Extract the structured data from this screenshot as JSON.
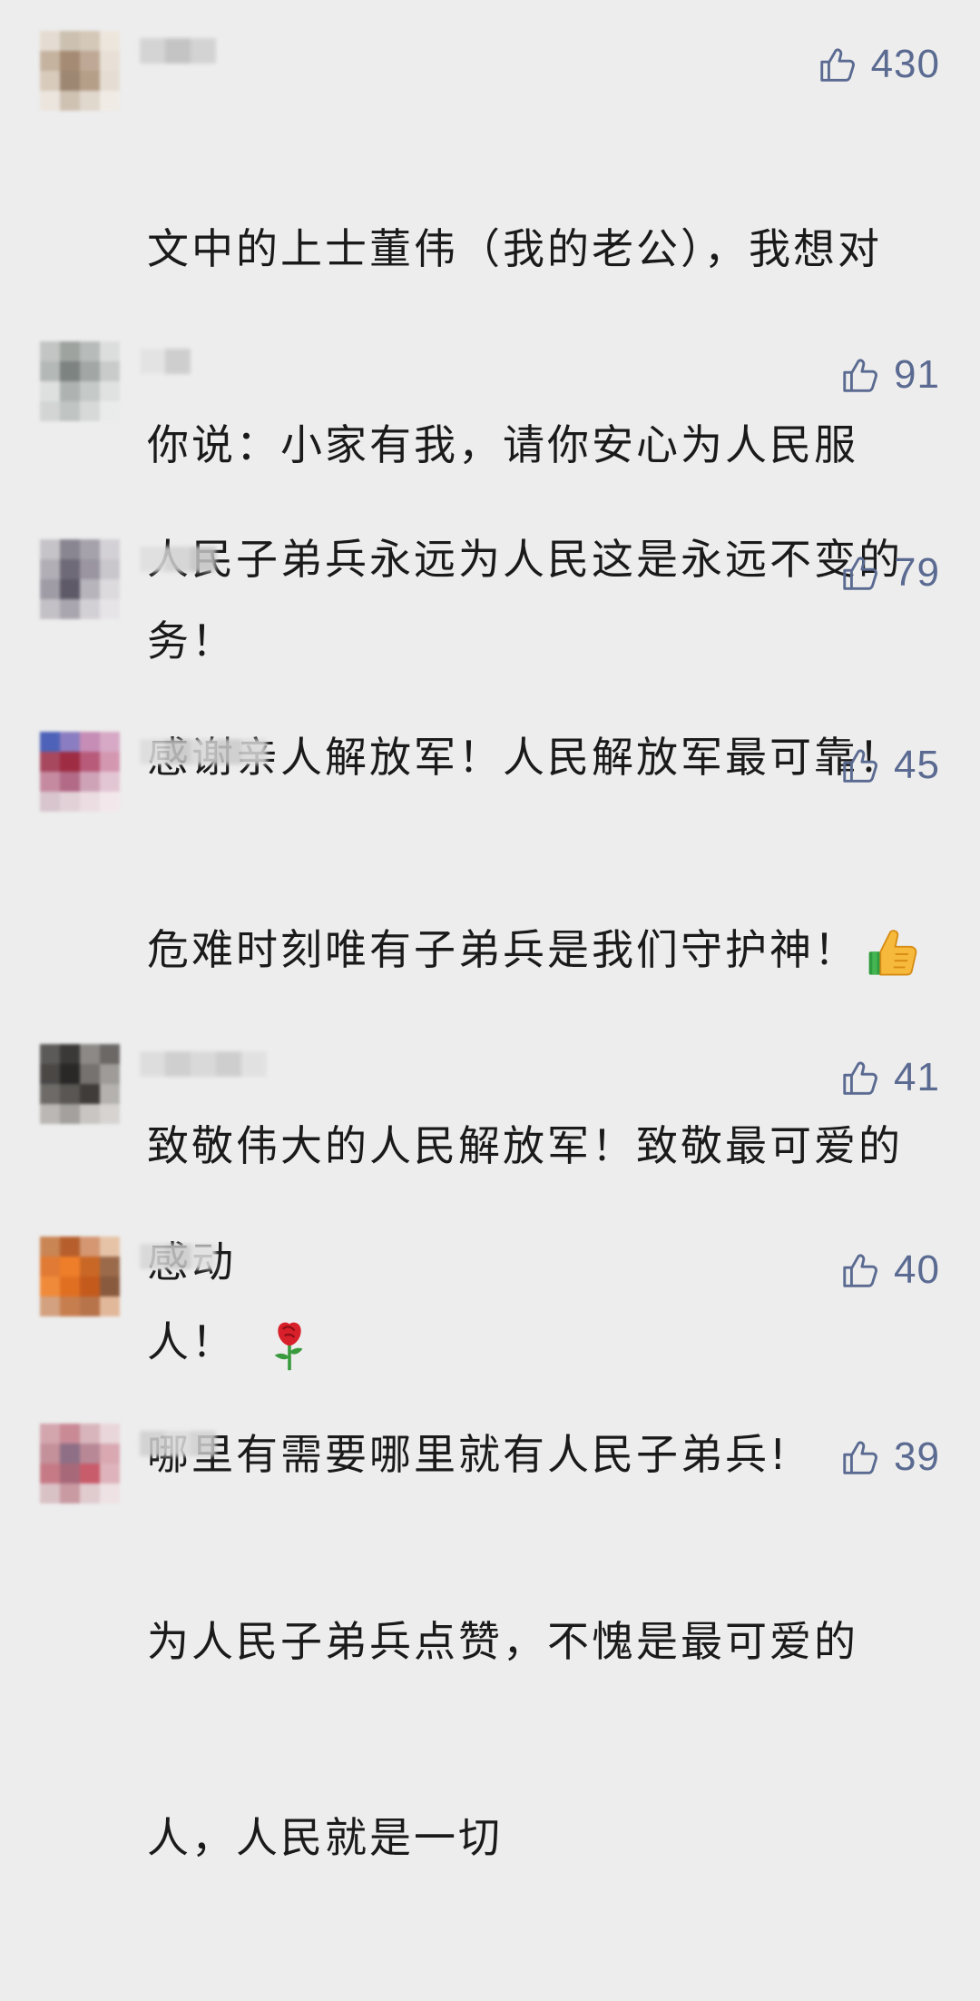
{
  "comments": [
    {
      "likes": "430",
      "text_lines": [
        "文中的上士董伟（我的老公），我想对",
        "你说：小家有我，请你安心为人民服",
        "务！"
      ],
      "avatar_colors": [
        "#e4dcd2",
        "#ccc1b1",
        "#d4c8b8",
        "#ede6dd",
        "#c5b3a0",
        "#a58b73",
        "#bfa996",
        "#e8e0d6",
        "#d8cbbb",
        "#9d8773",
        "#b59f89",
        "#e5ddd3",
        "#ebe5de",
        "#cfc2b3",
        "#e0d7cd",
        "#f0ebe5"
      ]
    },
    {
      "likes": "91",
      "text_lines": [
        "人民子弟兵永远为人民这是永远不变的"
      ],
      "avatar_colors": [
        "#c2c5c3",
        "#9ea3a0",
        "#b7bbb9",
        "#dcdedd",
        "#b4b8b6",
        "#7d8381",
        "#a2a7a5",
        "#c8cbca",
        "#dde0de",
        "#aeb3b1",
        "#c5c9c7",
        "#e0e2e1",
        "#d2d5d3",
        "#c0c4c2",
        "#d6d9d7",
        "#eaeceb"
      ]
    },
    {
      "likes": "79",
      "text_lines": [
        "感谢亲人解放军！人民解放军最可靠！"
      ],
      "avatar_colors": [
        "#c6c3c8",
        "#8a8691",
        "#a6a2ab",
        "#d4d1d6",
        "#b2aeb6",
        "#6f6a78",
        "#9a95a1",
        "#c9c6cc",
        "#a09ca6",
        "#5f5a68",
        "#b8b4bc",
        "#dcdadd",
        "#c3c0c6",
        "#aaa6af",
        "#d3d0d5",
        "#e6e4e7"
      ]
    },
    {
      "likes": "45",
      "text_lines": [
        "危难时刻唯有子弟兵是我们守护神！",
        "致敬伟大的人民解放军！致敬最可爱的",
        "人！"
      ],
      "thumbs_after_line": 0,
      "rose_after_line": 2,
      "avatar_colors": [
        "#4d62b8",
        "#8b7dc1",
        "#c68db6",
        "#d7a9c6",
        "#a8485f",
        "#9e2c43",
        "#b85b7a",
        "#d497b0",
        "#c58aa0",
        "#b26a86",
        "#cfa3b7",
        "#e3c6d3",
        "#d8c5cd",
        "#e2d2d8",
        "#ebdde2",
        "#f2e8ec"
      ]
    },
    {
      "likes": "41",
      "text_lines": [
        "感动"
      ],
      "avatar_colors": [
        "#5c5a58",
        "#3b3937",
        "#8c8986",
        "#6b6866",
        "#4a4745",
        "#2a2826",
        "#75726f",
        "#9e9b98",
        "#6d6a67",
        "#595653",
        "#3f3c3a",
        "#b4b1ae",
        "#bab7b4",
        "#a3a09d",
        "#c8c5c2",
        "#d6d3d0"
      ]
    },
    {
      "likes": "40",
      "text_lines": [
        "哪里有需要哪里就有人民子弟兵!"
      ],
      "avatar_colors": [
        "#c98554",
        "#b65f2d",
        "#d49772",
        "#e6c3a7",
        "#e07a34",
        "#ef7e2a",
        "#c96726",
        "#9b6a4b",
        "#f08a3b",
        "#e06f22",
        "#c45a1c",
        "#8a5a3e",
        "#d3a17f",
        "#c77e4f",
        "#b7734a",
        "#e2b89a"
      ]
    },
    {
      "likes": "39",
      "text_lines": [
        "为人民子弟兵点赞，不愧是最可爱的",
        "人，人民就是一切"
      ],
      "avatar_colors": [
        "#d3a5ad",
        "#c98a96",
        "#d8b5bc",
        "#e9d6da",
        "#c4909a",
        "#8e6f86",
        "#b88896",
        "#d9a8b1",
        "#c67a86",
        "#a7697a",
        "#c95c6b",
        "#deb3bb",
        "#d9c2c6",
        "#c99aa2",
        "#e0cbcf",
        "#eee2e4"
      ]
    }
  ],
  "colors": {
    "background": "#ededed",
    "like_accent": "#5a6a91",
    "text": "#1a1a1a"
  },
  "icons": {
    "like": "thumbs-up-outline-icon",
    "inline_emoji_1": "thumbs-up-emoji",
    "inline_emoji_2": "rose-emoji"
  }
}
